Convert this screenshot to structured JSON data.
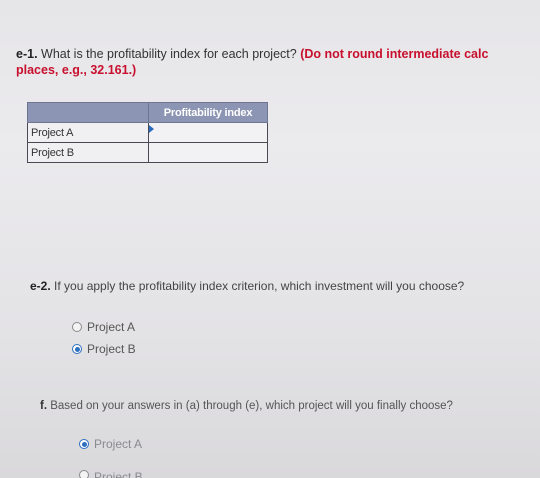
{
  "question_e1": {
    "number": "e-1.",
    "text": " What is the profitability index for each project? ",
    "instruction_line1": "(Do not round intermediate calc",
    "instruction_line2": "places, e.g., 32.161.)"
  },
  "pi_table": {
    "column_header": "Profitability index",
    "rows": [
      {
        "label": "Project A",
        "value": ""
      },
      {
        "label": "Project B",
        "value": ""
      }
    ]
  },
  "question_e2": {
    "number": "e-2.",
    "text": " If you apply the profitability index criterion, which investment will you choose?",
    "options": [
      {
        "label": "Project A",
        "selected": false
      },
      {
        "label": "Project B",
        "selected": true
      }
    ]
  },
  "question_f": {
    "number": "f.",
    "text": " Based on your answers in (a) through (e), which project will you finally choose?",
    "options": [
      {
        "label": "Project A",
        "selected": true
      },
      {
        "label": "Project B",
        "selected": false
      }
    ]
  },
  "colors": {
    "accent": "#2d6fc0",
    "instruction_red": "#c8102e",
    "table_header": "#8c95b3"
  }
}
